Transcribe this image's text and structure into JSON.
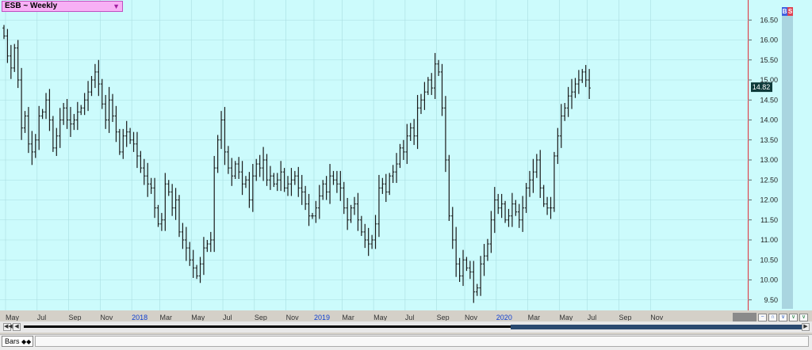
{
  "header": {
    "symbol_label": "ESB ~ Weekly",
    "dropdown_icon": "triangle-down-icon"
  },
  "toolbar": {
    "b_label": "B",
    "s_label": "S"
  },
  "status": {
    "tab_label": "Bars"
  },
  "colors": {
    "background": "#ccfbfc",
    "grid": "#a9dde0",
    "bars": "#1a1a1a",
    "marker": "#0e3a3a",
    "year_label": "#1040d0",
    "border": "#e0303a"
  },
  "chart_data": {
    "type": "bar",
    "subtype": "ohlc",
    "title": "",
    "ylim": [
      9.0,
      17.0
    ],
    "y_ticks": [
      "9.50",
      "10.00",
      "10.50",
      "11.00",
      "11.50",
      "12.00",
      "12.50",
      "13.00",
      "13.50",
      "14.00",
      "14.50",
      "15.00",
      "15.50",
      "16.00",
      "16.50"
    ],
    "last_price": "14.82",
    "x_tick_labels": [
      {
        "label": "May",
        "year": false,
        "i": 0
      },
      {
        "label": "Jul",
        "year": false,
        "i": 9
      },
      {
        "label": "Sep",
        "year": false,
        "i": 18
      },
      {
        "label": "Nov",
        "year": false,
        "i": 27
      },
      {
        "label": "2018",
        "year": true,
        "i": 36
      },
      {
        "label": "Mar",
        "year": false,
        "i": 44
      },
      {
        "label": "May",
        "year": false,
        "i": 53
      },
      {
        "label": "Jul",
        "year": false,
        "i": 62
      },
      {
        "label": "Sep",
        "year": false,
        "i": 71
      },
      {
        "label": "Nov",
        "year": false,
        "i": 80
      },
      {
        "label": "2019",
        "year": true,
        "i": 88
      },
      {
        "label": "Mar",
        "year": false,
        "i": 96
      },
      {
        "label": "May",
        "year": false,
        "i": 105
      },
      {
        "label": "Jul",
        "year": false,
        "i": 114
      },
      {
        "label": "Sep",
        "year": false,
        "i": 123
      },
      {
        "label": "Nov",
        "year": false,
        "i": 131
      },
      {
        "label": "2020",
        "year": true,
        "i": 140
      },
      {
        "label": "Mar",
        "year": false,
        "i": 149
      },
      {
        "label": "May",
        "year": false,
        "i": 158
      },
      {
        "label": "Jul",
        "year": false,
        "i": 166
      },
      {
        "label": "Sep",
        "year": false,
        "i": 175
      },
      {
        "label": "Nov",
        "year": false,
        "i": 184
      }
    ],
    "closes": [
      16.1,
      15.6,
      15.3,
      15.8,
      15.0,
      13.8,
      14.1,
      13.4,
      13.2,
      13.5,
      14.1,
      14.2,
      14.5,
      14.0,
      13.3,
      13.6,
      14.0,
      14.3,
      14.0,
      13.9,
      14.0,
      14.2,
      14.3,
      14.5,
      14.7,
      15.0,
      15.2,
      14.9,
      14.4,
      14.0,
      14.5,
      14.1,
      13.7,
      13.2,
      13.6,
      13.7,
      13.5,
      13.4,
      13.1,
      12.8,
      12.6,
      12.4,
      12.3,
      11.8,
      11.4,
      11.5,
      12.4,
      12.2,
      11.8,
      12.0,
      11.2,
      11.0,
      10.8,
      10.5,
      10.3,
      10.1,
      10.4,
      10.8,
      10.9,
      11.0,
      12.8,
      13.5,
      14.0,
      13.2,
      12.8,
      12.6,
      12.9,
      12.7,
      12.4,
      12.5,
      12.0,
      12.6,
      12.9,
      12.8,
      13.0,
      12.5,
      12.6,
      12.4,
      12.5,
      12.7,
      12.3,
      12.4,
      12.5,
      12.6,
      12.3,
      12.2,
      11.9,
      11.6,
      11.6,
      11.8,
      12.1,
      12.4,
      12.2,
      12.6,
      12.5,
      12.4,
      12.3,
      11.8,
      11.5,
      11.8,
      11.9,
      11.5,
      11.2,
      11.0,
      10.9,
      11.0,
      11.4,
      12.3,
      12.4,
      12.2,
      12.6,
      12.7,
      12.9,
      13.3,
      13.2,
      13.6,
      13.8,
      13.6,
      14.3,
      14.5,
      14.7,
      15.0,
      14.8,
      15.4,
      15.2,
      14.3,
      13.0,
      11.6,
      11.0,
      10.4,
      10.1,
      10.5,
      10.3,
      10.2,
      9.7,
      9.8,
      10.4,
      10.6,
      10.9,
      11.5,
      12.0,
      11.8,
      11.9,
      11.5,
      11.6,
      11.9,
      11.7,
      11.5,
      11.8,
      12.3,
      12.5,
      12.7,
      13.0,
      12.3,
      11.9,
      11.8,
      11.8,
      13.1,
      13.6,
      14.1,
      14.3,
      14.6,
      14.7,
      14.9,
      15.0,
      15.2,
      15.0,
      14.8
    ]
  }
}
